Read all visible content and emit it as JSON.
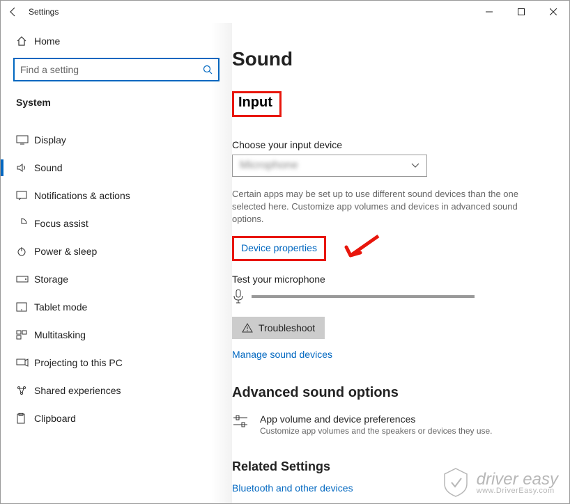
{
  "window": {
    "title": "Settings"
  },
  "sidebar": {
    "home_label": "Home",
    "search_placeholder": "Find a setting",
    "heading": "System",
    "items": [
      {
        "label": "Display",
        "icon": "display-icon"
      },
      {
        "label": "Sound",
        "icon": "sound-icon"
      },
      {
        "label": "Notifications & actions",
        "icon": "notifications-icon"
      },
      {
        "label": "Focus assist",
        "icon": "focus-assist-icon"
      },
      {
        "label": "Power & sleep",
        "icon": "power-icon"
      },
      {
        "label": "Storage",
        "icon": "storage-icon"
      },
      {
        "label": "Tablet mode",
        "icon": "tablet-icon"
      },
      {
        "label": "Multitasking",
        "icon": "multitasking-icon"
      },
      {
        "label": "Projecting to this PC",
        "icon": "projecting-icon"
      },
      {
        "label": "Shared experiences",
        "icon": "shared-icon"
      },
      {
        "label": "Clipboard",
        "icon": "clipboard-icon"
      }
    ]
  },
  "main": {
    "page_title": "Sound",
    "input_heading": "Input",
    "choose_label": "Choose your input device",
    "dropdown_value": "Microphone",
    "help_text": "Certain apps may be set up to use different sound devices than the one selected here. Customize app volumes and devices in advanced sound options.",
    "device_properties_link": "Device properties",
    "test_mic_label": "Test your microphone",
    "troubleshoot_label": "Troubleshoot",
    "manage_link": "Manage sound devices",
    "advanced_heading": "Advanced sound options",
    "adv_item_title": "App volume and device preferences",
    "adv_item_sub": "Customize app volumes and the speakers or devices they use.",
    "related_heading": "Related Settings",
    "bluetooth_link": "Bluetooth and other devices"
  },
  "watermark": {
    "brand": "driver easy",
    "url": "www.DriverEasy.com"
  }
}
